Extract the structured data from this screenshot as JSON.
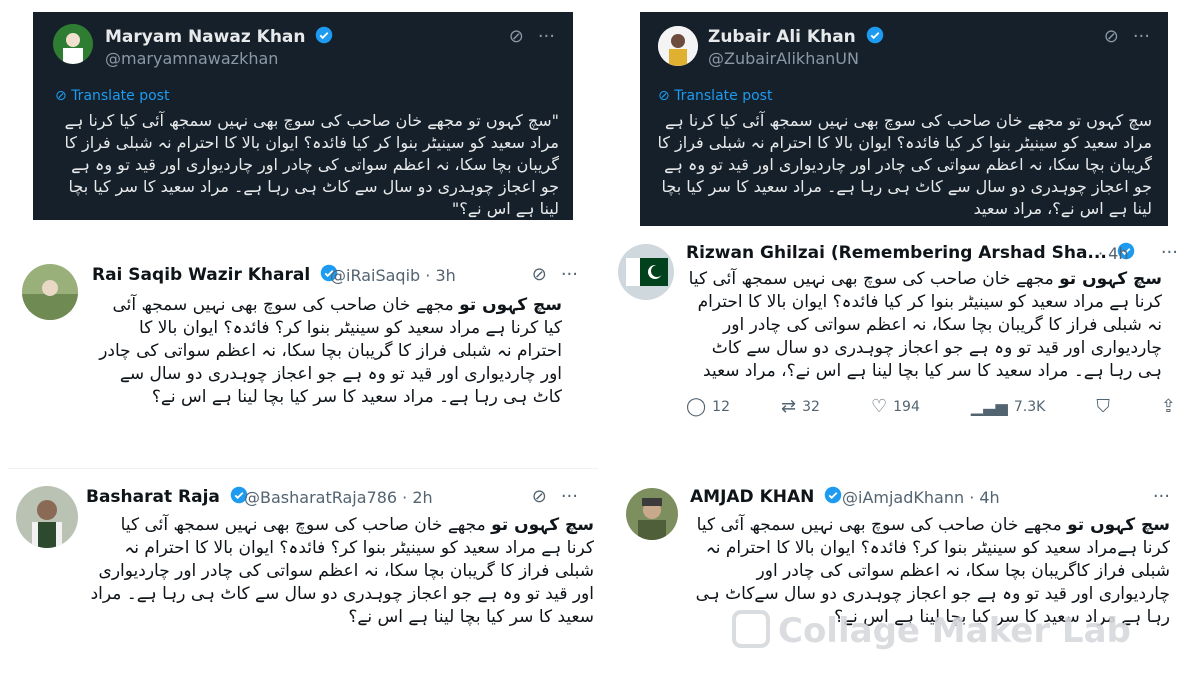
{
  "tweets": {
    "top_left": {
      "name": "Maryam Nawaz Khan",
      "handle": "@maryamnawazkhan",
      "translate": "Translate post",
      "text": "\"سچ کہوں تو مجھے خان صاحب کی سوچ بھی نہیں سمجھ آئی کیا کرنا ہے مراد سعید کو سینیٹر بنوا کر کیا فائدہ؟ ایوان بالا کا احترام نہ شبلی فراز کا گریبان بچا سکا، نہ اعظم سواتی کی چادر اور چاردیواری اور قید تو وہ ہے جو اعجاز چوہدری دو سال سے کاٹ ہی رہا ہے۔ مراد سعید کا سر کیا بچا لینا ہے اس نے؟\""
    },
    "top_right": {
      "name": "Zubair Ali Khan",
      "handle": "@ZubairAlikhanUN",
      "translate": "Translate post",
      "text": "سچ کہوں تو مجھے خان صاحب کی سوچ بھی نہیں سمجھ آئی کیا کرنا ہے مراد سعید کو سینیٹر بنوا کر کیا فائدہ؟ ایوان بالا کا احترام نہ شبلی فراز کا گریبان بچا سکا، نہ اعظم سواتی کی چادر اور چاردیواری اور قید تو وہ ہے جو اعجاز چوہدری دو سال سے کاٹ ہی رہا ہے۔ مراد سعید کا سر کیا بچا لینا ہے اس نے؟، مراد سعید"
    },
    "mid_left": {
      "name": "Rai Saqib Wazir Kharal",
      "handle": "@iRaiSaqib · 3h",
      "text_bold": "سچ کہوں تو",
      "text": "مجھے خان صاحب کی سوچ بھی نہیں سمجھ آئی کیا کرنا ہے مراد سعید کو سینیٹر بنوا کر؟ فائدہ؟ ایوان بالا کا احترام نہ شبلی فراز کا گریبان بچا سکا، نہ اعظم سواتی کی چادر اور چاردیواری اور قید تو وہ ہے جو اعجاز چوہدری دو سال سے کاٹ ہی رہا ہے۔ مراد سعید کا سر کیا بچا لینا ہے اس نے؟"
    },
    "mid_right": {
      "name": "Rizwan Ghilzai (Remembering Arshad Sha...",
      "handle": "· 4h",
      "text_bold": "سچ کہوں تو",
      "text": "مجھے خان صاحب کی سوچ بھی نہیں سمجھ آئی کیا کرنا ہے مراد سعید کو سینیٹر بنوا کر کیا فائدہ؟ ایوان بالا کا احترام نہ شبلی فراز کا گریبان بچا سکا، نہ اعظم سواتی کی چادر اور چاردیواری اور قید تو وہ ہے جو اعجاز چوہدری دو سال سے کاٹ ہی رہا ہے۔ مراد سعید کا سر کیا بچا لینا ہے اس نے؟، مراد سعید",
      "replies": "12",
      "reposts": "32",
      "likes": "194",
      "views": "7.3K"
    },
    "bottom_left": {
      "name": "Basharat Raja",
      "handle": "@BasharatRaja786 · 2h",
      "text_bold": "سچ کہوں تو",
      "text": "مجھے خان صاحب کی سوچ بھی نہیں سمجھ آئی کیا کرنا ہے مراد سعید کو سینیٹر بنوا کر؟ فائدہ؟ ایوان بالا کا احترام نہ شبلی فراز کا گریبان بچا سکا، نہ اعظم سواتی کی چادر اور چاردیواری اور قید تو وہ ہے جو اعجاز چوہدری دو سال سے کاٹ ہی رہا ہے۔ مراد سعید کا سر کیا بچا لینا ہے اس نے؟"
    },
    "bottom_right": {
      "name": "AMJAD KHAN",
      "handle": "@iAmjadKhann · 4h",
      "text_bold": "سچ کہوں تو",
      "text": "مجھے خان صاحب کی سوچ بھی نہیں سمجھ آئی کیا کرنا ہےمراد سعید کو سینیٹر بنوا کر؟ فائدہ؟ ایوان بالا کا احترام نہ شبلی فراز کاگریبان بچا سکا، نہ اعظم سواتی کی چادر اور چاردیواری اور قید تو وہ ہے جو اعجاز چوہدری دو سال سےکاٹ ہی رہا ہے مراد سعید کا سر کیا بچا لینا ہے اس نے؟"
    }
  },
  "watermark": "Collage Maker Lab",
  "colors": {
    "verified": "#1d9bf0",
    "dark_bg": "#15202b"
  }
}
